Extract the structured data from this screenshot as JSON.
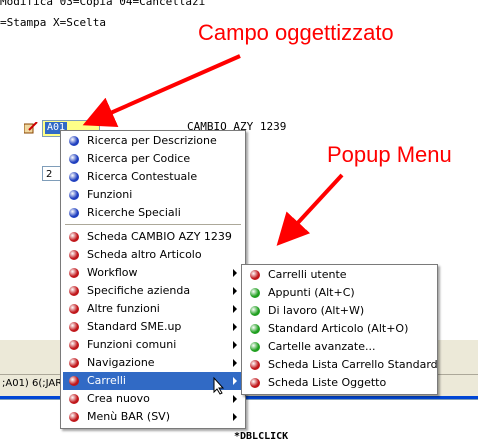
{
  "background": {
    "line1": "Modifica 03=Copia 04=Cancellazi",
    "line2": "=Stampa X=Scelta",
    "code_text": "CAMBIO AZY 1239",
    "object_field_value": "A01",
    "quantity_field_value": "2",
    "status_text": ";A01) 6(;JAR",
    "bottom_tag": "*DBLCLICK"
  },
  "callouts": {
    "field": "Campo oggettizzato",
    "popup": "Popup Menu",
    "color": "#ff0000"
  },
  "context_menu": {
    "items": [
      {
        "label": "Ricerca per Descrizione",
        "icon": "blue-dot-icon",
        "submenu": false
      },
      {
        "label": "Ricerca per Codice",
        "icon": "blue-dot-icon",
        "submenu": false
      },
      {
        "label": "Ricerca Contestuale",
        "icon": "blue-dot-icon",
        "submenu": false
      },
      {
        "label": "Funzioni",
        "icon": "blue-dot-icon",
        "submenu": false
      },
      {
        "label": "Ricerche Speciali",
        "icon": "blue-dot-icon",
        "submenu": false
      },
      {
        "label": "Scheda CAMBIO AZY 1239",
        "icon": "red-dot-icon",
        "submenu": false
      },
      {
        "label": "Scheda altro Articolo",
        "icon": "red-dot-icon",
        "submenu": false
      },
      {
        "label": "Workflow",
        "icon": "red-dot-icon",
        "submenu": true
      },
      {
        "label": "Specifiche azienda",
        "icon": "red-dot-icon",
        "submenu": true
      },
      {
        "label": "Altre funzioni",
        "icon": "red-dot-icon",
        "submenu": true
      },
      {
        "label": "Standard SME.up",
        "icon": "red-dot-icon",
        "submenu": true
      },
      {
        "label": "Funzioni comuni",
        "icon": "red-dot-icon",
        "submenu": true
      },
      {
        "label": "Navigazione",
        "icon": "red-dot-icon",
        "submenu": true
      },
      {
        "label": "Carrelli",
        "icon": "red-dot-icon",
        "submenu": true,
        "selected": true
      },
      {
        "label": "Crea nuovo",
        "icon": "red-dot-icon",
        "submenu": true
      },
      {
        "label": "Menù BAR (SV)",
        "icon": "red-dot-icon",
        "submenu": true
      }
    ]
  },
  "cart_submenu": {
    "items": [
      {
        "label": "Carrelli utente",
        "icon": "red-dot-icon"
      },
      {
        "label": "Appunti (Alt+C)",
        "icon": "green-dot-icon"
      },
      {
        "label": "Di lavoro (Alt+W)",
        "icon": "green-dot-icon"
      },
      {
        "label": "Standard Articolo (Alt+O)",
        "icon": "green-dot-icon"
      },
      {
        "label": "Cartelle avanzate...",
        "icon": "green-dot-icon"
      },
      {
        "label": "Scheda Lista Carrello Standard",
        "icon": "red-dot-icon"
      },
      {
        "label": "Scheda Liste Oggetto",
        "icon": "red-dot-icon"
      }
    ]
  },
  "colors": {
    "selection": "#316ac5",
    "field_bg": "#ffff88",
    "blue_dot": "#1f3fbf",
    "red_dot": "#c0161a",
    "green_dot": "#1f9f1f"
  }
}
